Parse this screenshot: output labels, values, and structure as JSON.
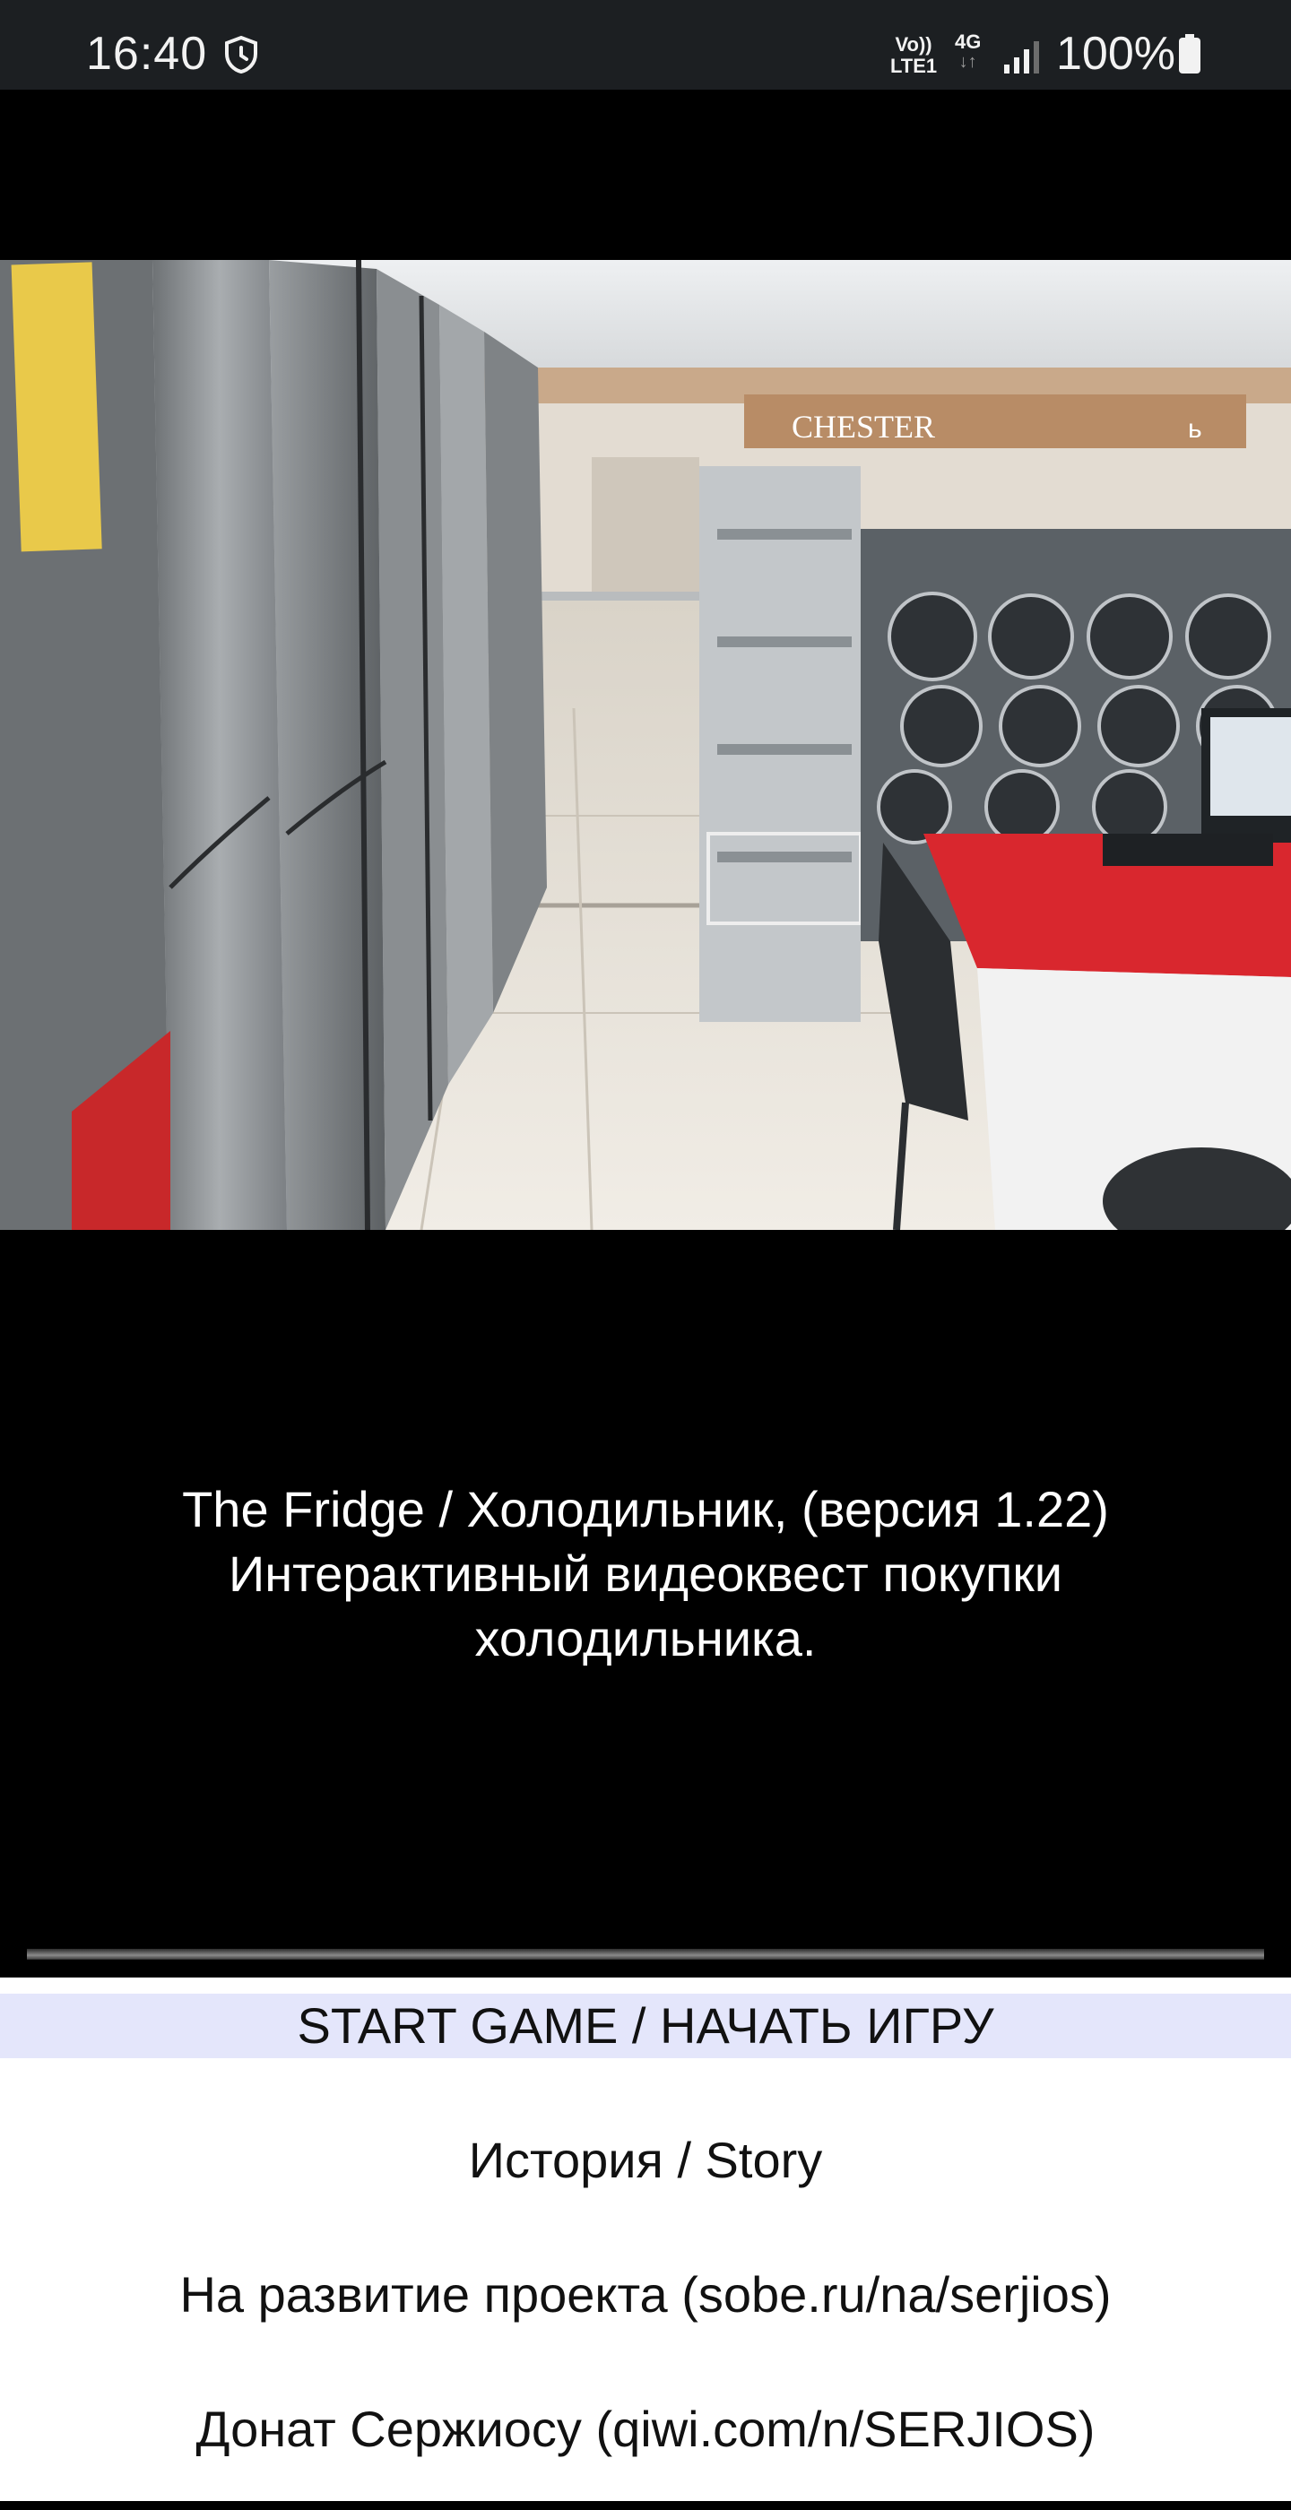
{
  "status_bar": {
    "time": "16:40",
    "volte_top": "Vo))",
    "volte_bottom": "LTE1",
    "network": "4G",
    "network_arrows": "↓↑",
    "battery_percent": "100%",
    "icons": [
      "shield-clock-icon",
      "signal-icon",
      "battery-icon"
    ]
  },
  "scene": {
    "store_sign": "CHESTER",
    "store_sign_2": "ь"
  },
  "title": {
    "line1": "The Fridge / Холодильник, (версия 1.22)",
    "line2": "Интерактивный видеоквест покупки",
    "line3": "холодильника."
  },
  "menu": {
    "items": [
      {
        "label": "START GAME / НАЧАТЬ ИГРУ",
        "selected": true
      },
      {
        "label": "История / Story",
        "selected": false
      },
      {
        "label": "На развитие проекта (sobe.ru/na/serjios)",
        "selected": false
      },
      {
        "label": "Донат Сержиосу (qiwi.com/n/SERJIOS)",
        "selected": false
      }
    ]
  },
  "colors": {
    "background": "#000000",
    "status_bar": "#1c1f22",
    "menu_background": "#ffffff",
    "menu_selected": "#e4e6fb",
    "desk_red": "#d9272e"
  }
}
